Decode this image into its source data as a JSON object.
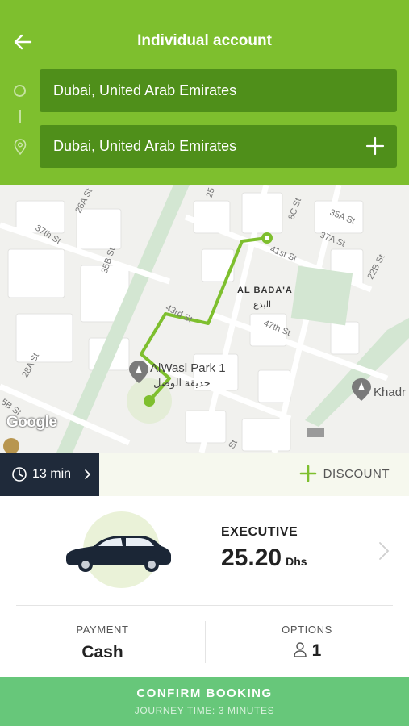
{
  "header": {
    "title": "Individual account",
    "origin": "Dubai, United Arab Emirates",
    "destination": "Dubai, United Arab Emirates",
    "background_color": "#7ebf2e"
  },
  "map": {
    "streets": [
      "26A St",
      "35B St",
      "37th St",
      "28A St",
      "5B St",
      "25",
      "8C St",
      "35A St",
      "37A St",
      "22B St",
      "41st St",
      "43rd St",
      "47th St",
      "St"
    ],
    "places": [
      {
        "name": "AlWasl Park 1",
        "name_ar": "حديقة الوصل"
      },
      {
        "name": "AL BADA'A",
        "name_ar": "البدع"
      },
      {
        "name": "Khadr"
      }
    ],
    "attribution": "Google",
    "route_color": "#7ebf2e"
  },
  "eta": {
    "label": "13 min"
  },
  "discount": {
    "label": "DISCOUNT"
  },
  "vehicle": {
    "class_name": "EXECUTIVE",
    "price": "25.20",
    "currency": "Dhs"
  },
  "payment": {
    "caption": "PAYMENT",
    "value": "Cash"
  },
  "options": {
    "caption": "OPTIONS",
    "value": "1"
  },
  "confirm": {
    "title": "CONFIRM BOOKING",
    "subtitle": "JOURNEY TIME: 3 MINUTES",
    "color": "#67c77a"
  }
}
